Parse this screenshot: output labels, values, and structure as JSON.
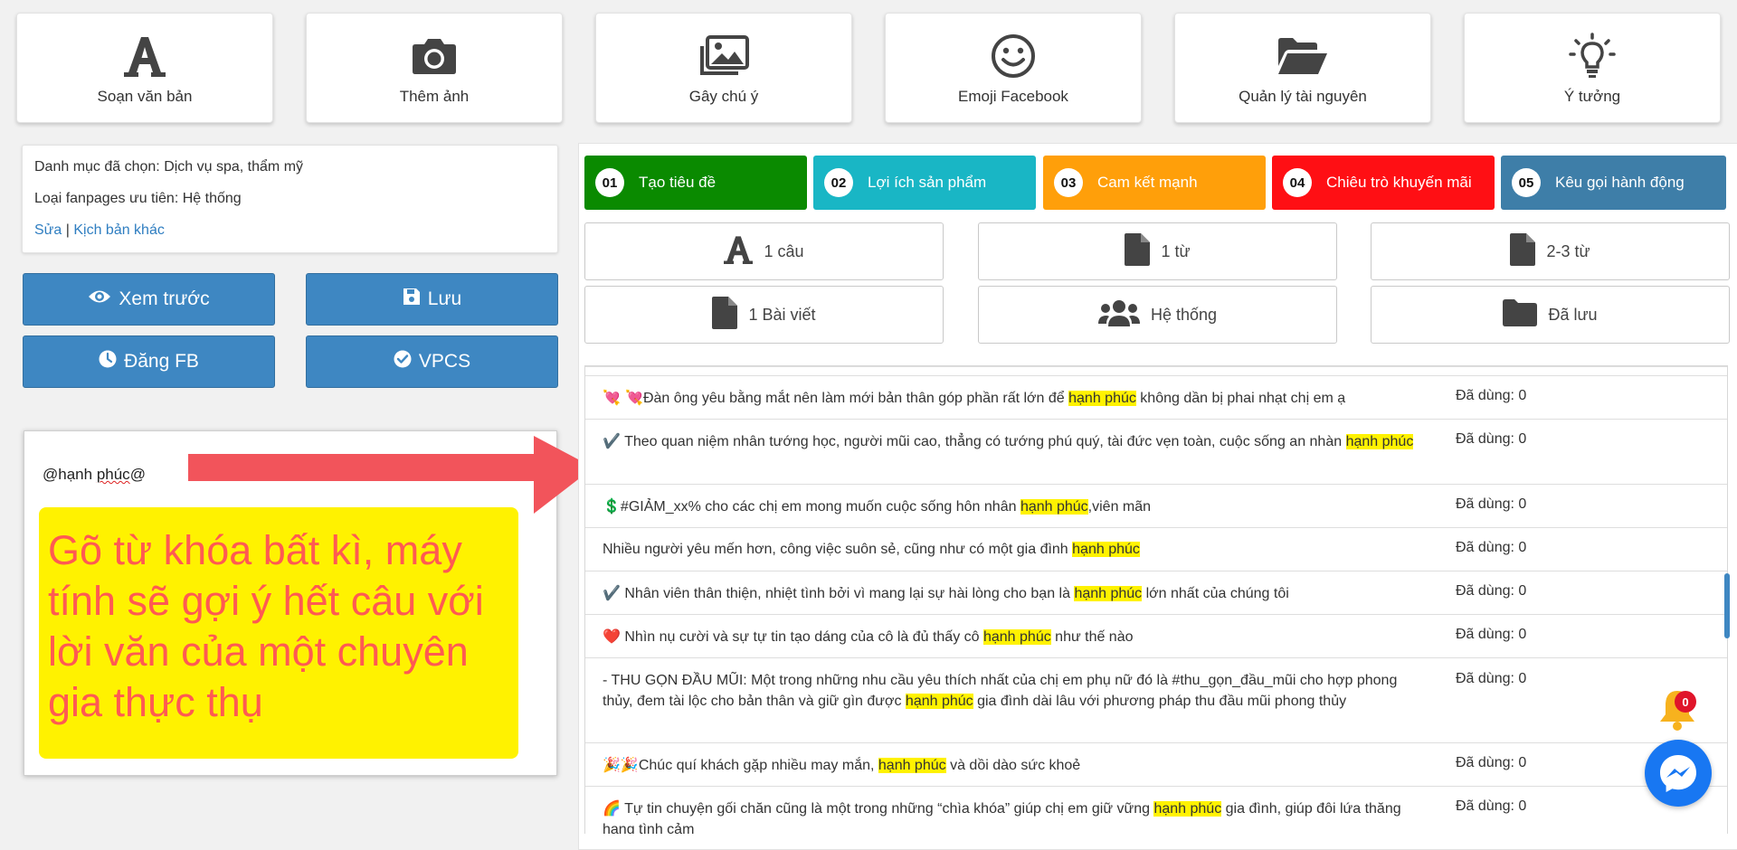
{
  "toolbar": {
    "items": [
      {
        "label": "Soạn văn bản",
        "icon": "font-icon"
      },
      {
        "label": "Thêm ảnh",
        "icon": "camera-icon"
      },
      {
        "label": "Gây chú ý",
        "icon": "images-icon"
      },
      {
        "label": "Emoji Facebook",
        "icon": "smile-icon"
      },
      {
        "label": "Quản lý tài nguyên",
        "icon": "folder-open-icon"
      },
      {
        "label": "Ý tưởng",
        "icon": "lightbulb-icon"
      }
    ]
  },
  "info": {
    "category": "Danh mục đã chọn: Dịch vụ spa, thẩm mỹ",
    "fanpage": "Loại fanpages ưu tiên: Hệ thống",
    "edit_link": "Sửa",
    "separator": "|",
    "other_script_link": "Kịch bản khác"
  },
  "actions": {
    "preview": "Xem trước",
    "save": "Lưu",
    "post_fb": "Đăng FB",
    "vpcs": "VPCS"
  },
  "editor": {
    "text_prefix": "@hạnh ",
    "text_misspelled": "phúc",
    "text_suffix": "@",
    "callout": "Gõ từ khóa bất kì, máy tính sẽ gợi ý hết câu với lời văn của một chuyên gia thực thụ"
  },
  "steps": [
    {
      "num": "01",
      "label": "Tạo tiêu đề",
      "color": "#0a8a00"
    },
    {
      "num": "02",
      "label": "Lợi ích sản phẩm",
      "color": "#19b6c5"
    },
    {
      "num": "03",
      "label": "Cam kết mạnh",
      "color": "#ff9f0a"
    },
    {
      "num": "04",
      "label": "Chiêu trò khuyến mãi",
      "color": "#ff0f14"
    },
    {
      "num": "05",
      "label": "Kêu gọi hành động",
      "color": "#3e7ea8"
    }
  ],
  "filters": [
    {
      "label": "1 câu",
      "icon": "font-icon"
    },
    {
      "label": "1 từ",
      "icon": "file-icon"
    },
    {
      "label": "2-3 từ",
      "icon": "file-icon"
    },
    {
      "label": "1 Bài viết",
      "icon": "file-icon"
    },
    {
      "label": "Hệ thống",
      "icon": "users-icon"
    },
    {
      "label": "Đã lưu",
      "icon": "folder-icon"
    }
  ],
  "highlight_word": "hạnh phúc",
  "results": [
    {
      "emoji": "💘 💘",
      "pre": "Đàn ông yêu bằng mắt nên làm mới bản thân góp phần rất lớn để ",
      "post": " không dần bị phai nhạt chị em ạ",
      "used": "Đã dùng: 0"
    },
    {
      "emoji": "✔️",
      "pre": " Theo quan niệm nhân tướng học, người mũi cao, thẳng có tướng phú quý, tài đức vẹn toàn, cuộc sống an nhàn ",
      "post": "",
      "used": "Đã dùng: 0"
    },
    {
      "emoji": "💲",
      "pre": "#GIẢM_xx% cho các chị em mong muốn cuộc sống hôn nhân ",
      "post": ",viên mãn",
      "used": "Đã dùng: 0"
    },
    {
      "emoji": "",
      "pre": "Nhiều người yêu mến hơn, công việc suôn sẻ, cũng như có một gia đình ",
      "post": "",
      "used": "Đã dùng: 0"
    },
    {
      "emoji": "✔️",
      "pre": " Nhân viên thân thiện, nhiệt tình bởi vì mang lại sự hài lòng cho bạn là ",
      "post": " lớn nhất của chúng tôi",
      "used": "Đã dùng: 0"
    },
    {
      "emoji": "❤️",
      "pre": " Nhìn nụ cười và sự tự tin tạo dáng của cô là đủ thấy cô ",
      "post": " như thế nào",
      "used": "Đã dùng: 0"
    },
    {
      "emoji": "",
      "pre": "- THU GỌN ĐẦU MŨI: Một trong những nhu cầu yêu thích nhất của chị em phụ nữ đó là #thu_gọn_đầu_mũi cho hợp phong thủy, đem tài lộc cho bản thân và giữ gìn được ",
      "post": " gia đình dài lâu với phương pháp thu đầu mũi phong thủy",
      "used": "Đã dùng: 0"
    },
    {
      "emoji": "🎉🎉",
      "pre": "Chúc quí khách gặp nhiều may mắn, ",
      "post": " và dồi dào sức khoẻ",
      "used": "Đã dùng: 0"
    },
    {
      "emoji": "🌈",
      "pre": " Tự tin chuyện gối chăn cũng là một trong những “chìa khóa” giúp chị em giữ vững ",
      "post": " gia đình, giúp đôi lứa thăng hạng tình cảm",
      "used": "Đã dùng: 0"
    }
  ],
  "notification": {
    "count": "0"
  }
}
